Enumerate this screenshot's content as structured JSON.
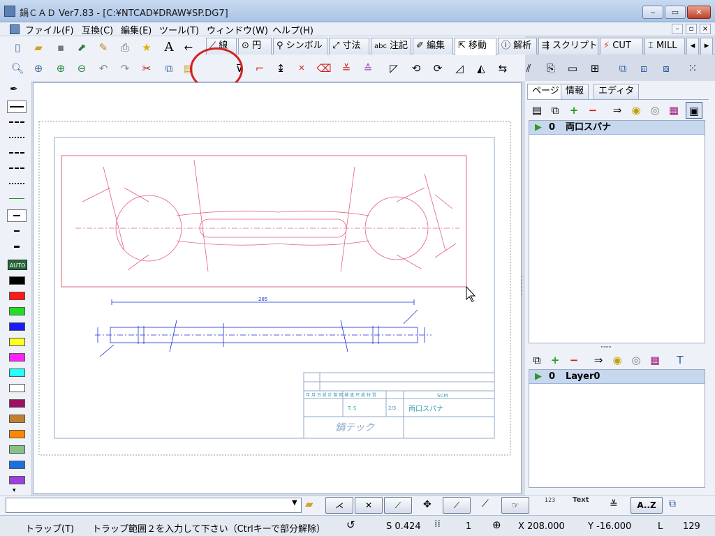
{
  "window": {
    "title": "鍋ＣＡＤ Ver7.83 - [C:¥NTCAD¥DRAW¥SP.DG7]"
  },
  "menu": [
    "ファイル(F)",
    "互換(C)",
    "編集(E)",
    "ツール(T)",
    "ウィンドウ(W)",
    "ヘルプ(H)"
  ],
  "toolbar": {
    "tabs": [
      "線",
      "円",
      "シンボル",
      "寸法",
      "注記",
      "編集",
      "移動",
      "解析",
      "スクリプト",
      "CUT",
      "MILL"
    ],
    "tab_prefix": {
      "circle": "⊙",
      "dim": "⤢",
      "note": "abc",
      "info": "ⓘ"
    },
    "active_tab": "移動"
  },
  "right_panel": {
    "tabs": [
      "ページ",
      "情報",
      "エディタ"
    ],
    "pages": [
      {
        "num": "0",
        "name": "両口スパナ"
      }
    ],
    "layers": [
      {
        "num": "0",
        "name": "Layer0"
      }
    ]
  },
  "drawing": {
    "dim_main": "285",
    "title_block": {
      "headers": [
        "年",
        "月",
        "日",
        "設",
        "計",
        "製",
        "図",
        "検",
        "査",
        "尺",
        "度",
        "材",
        "質"
      ],
      "material": "SCM",
      "drafter": "T. S",
      "scale": "2/3",
      "part_name": "両口スパナ",
      "company": "鍋テック"
    }
  },
  "bottom": {
    "text_button": "Text",
    "az_button": "A..Z",
    "counter_icon": "123"
  },
  "status": {
    "mode": "トラップ(T)",
    "message": "トラップ範囲２を入力して下さい（Ctrlキーで部分解除）",
    "snap": "S 0.424",
    "count": "1",
    "x": "X 208.000",
    "y": "Y -16.000",
    "l_label": "L",
    "l_value": "129"
  },
  "colors": {
    "accent": "#2b4a78",
    "drawing_pink": "#e0607e",
    "drawing_blue": "#1a2fd0",
    "frame": "#8fa8c8",
    "highlight_ring": "#d42020"
  }
}
